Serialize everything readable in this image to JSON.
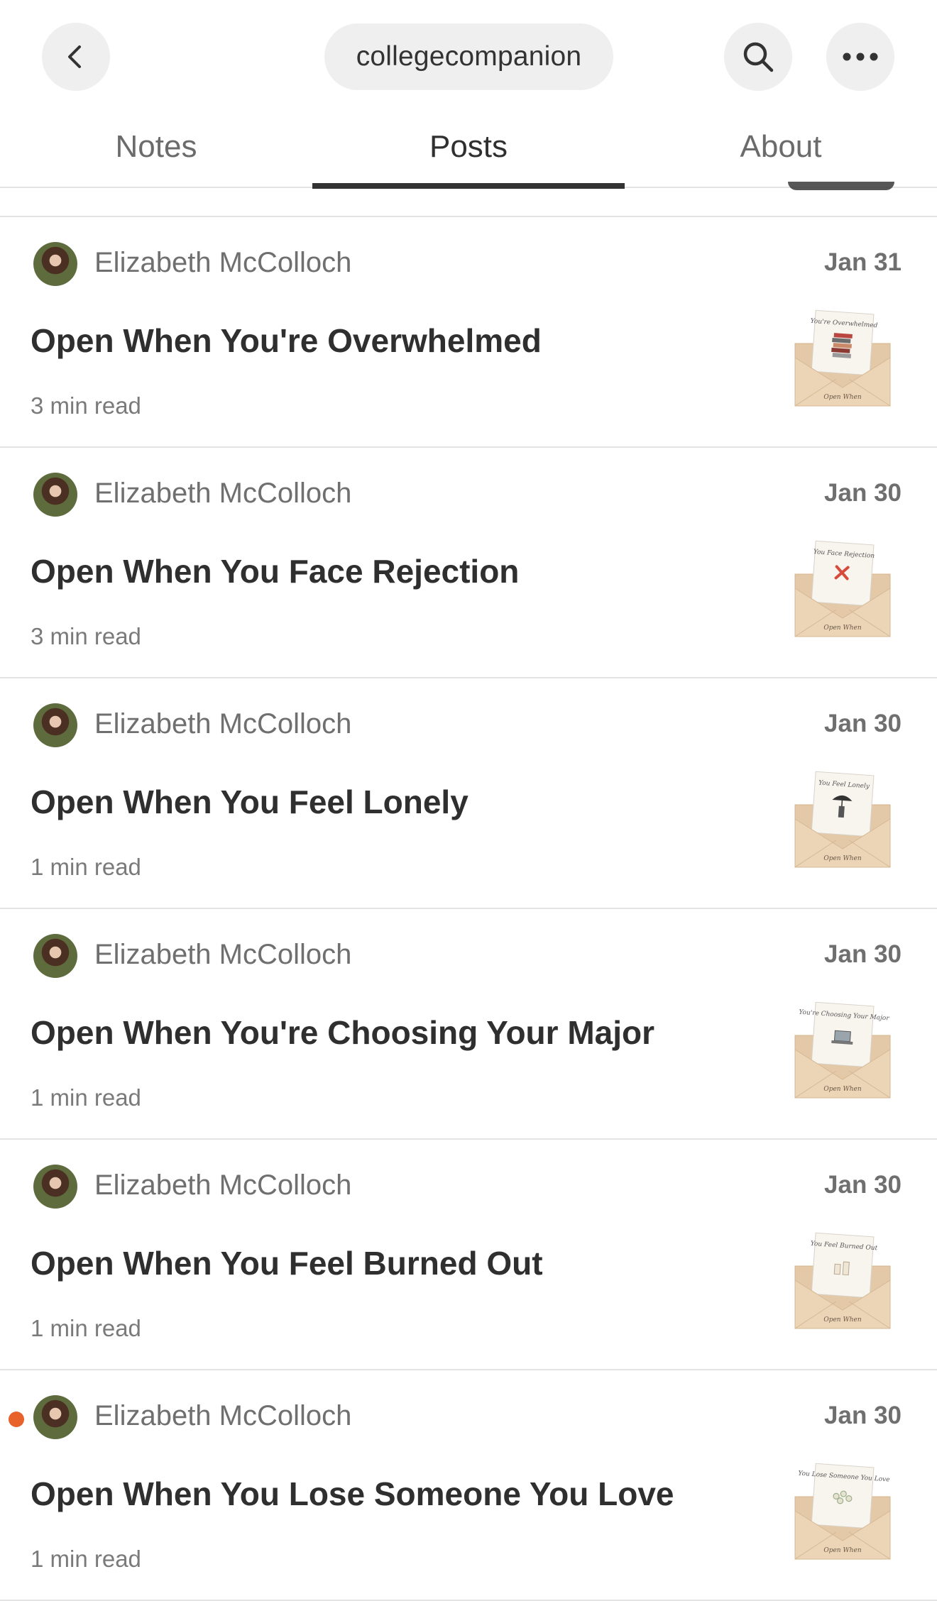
{
  "header": {
    "publication_name": "collegecompanion",
    "icons": {
      "back": "chevron-left-icon",
      "search": "search-icon",
      "more": "ellipsis-icon"
    }
  },
  "tabs": [
    {
      "label": "Notes",
      "active": false
    },
    {
      "label": "Posts",
      "active": true
    },
    {
      "label": "About",
      "active": false
    }
  ],
  "accent_color": "#e8622c",
  "posts": [
    {
      "author": "Elizabeth McColloch",
      "date": "Jan 31",
      "title": "Open When You're Overwhelmed",
      "read_time": "3 min read",
      "thumb_icon": "books-stack-icon",
      "thumb_caption": "You're Overwhelmed",
      "unread": false
    },
    {
      "author": "Elizabeth McColloch",
      "date": "Jan 30",
      "title": "Open When You Face Rejection",
      "read_time": "3 min read",
      "thumb_icon": "red-x-icon",
      "thumb_caption": "You Face Rejection",
      "unread": false
    },
    {
      "author": "Elizabeth McColloch",
      "date": "Jan 30",
      "title": "Open When You Feel Lonely",
      "read_time": "1 min read",
      "thumb_icon": "umbrella-figure-icon",
      "thumb_caption": "You Feel Lonely",
      "unread": false
    },
    {
      "author": "Elizabeth McColloch",
      "date": "Jan 30",
      "title": "Open When You're Choosing Your Major",
      "read_time": "1 min read",
      "thumb_icon": "laptop-icon",
      "thumb_caption": "You're Choosing Your Major",
      "unread": false
    },
    {
      "author": "Elizabeth McColloch",
      "date": "Jan 30",
      "title": "Open When You Feel Burned Out",
      "read_time": "1 min read",
      "thumb_icon": "candles-icon",
      "thumb_caption": "You Feel Burned Out",
      "unread": false
    },
    {
      "author": "Elizabeth McColloch",
      "date": "Jan 30",
      "title": "Open When You Lose Someone You Love",
      "read_time": "1 min read",
      "thumb_icon": "flowers-icon",
      "thumb_caption": "You Lose Someone You Love",
      "unread": true
    }
  ],
  "thumb_footer": "Open When"
}
